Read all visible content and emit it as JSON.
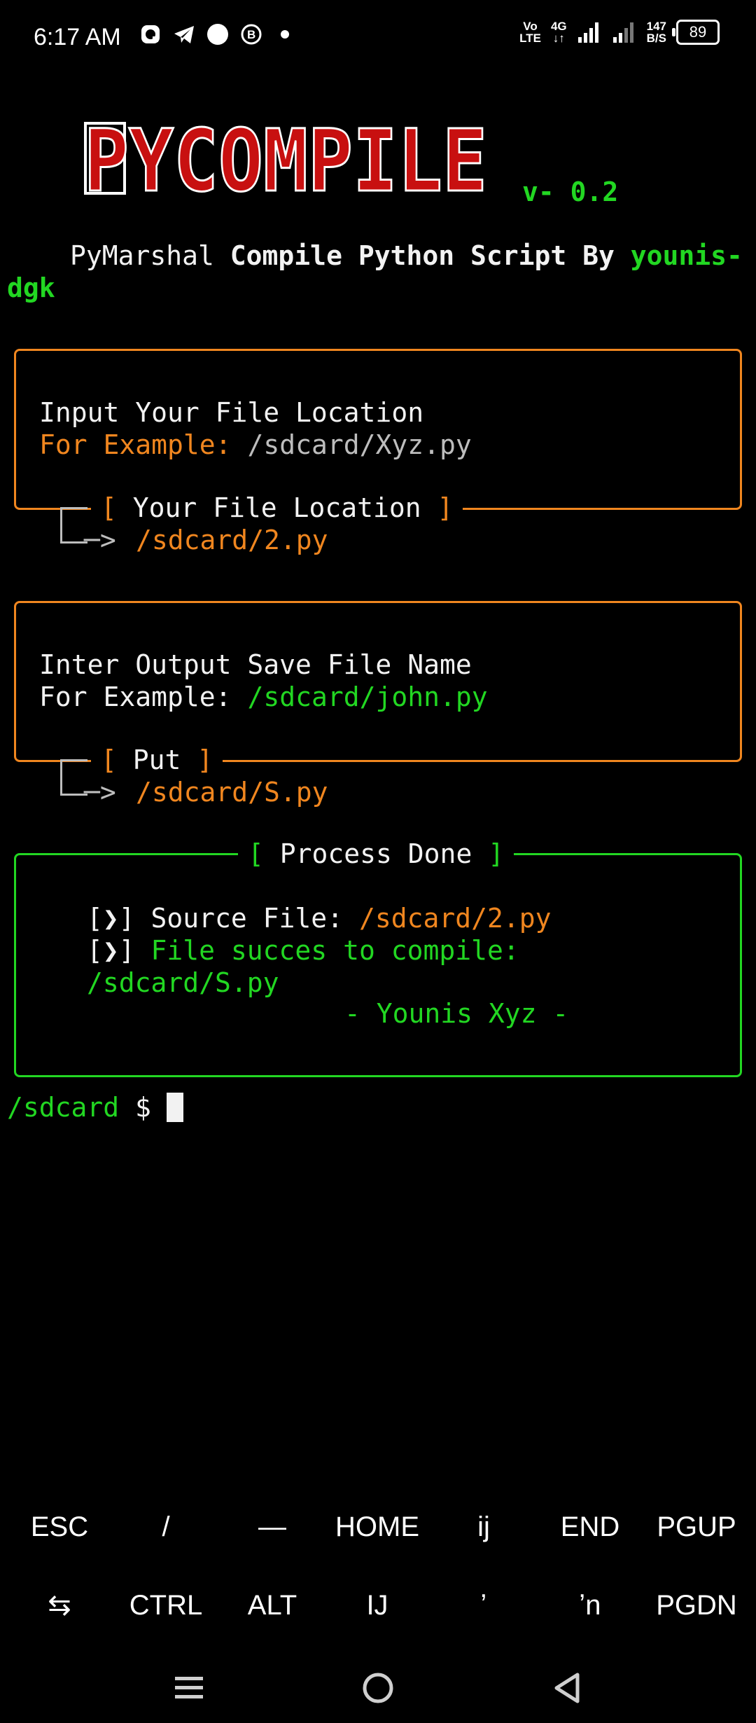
{
  "status_bar": {
    "time": "6:17 AM",
    "volte": "Vo\nLTE",
    "network": "4G",
    "speed": "147\nB/S",
    "battery": "89"
  },
  "header": {
    "logo_text": "PYCOMPILE",
    "version": "v- 0.2",
    "subtitle_prefix": "PyMarshal",
    "subtitle_main": "Compile Python Script By",
    "author": "younis-",
    "author_cont": "dgk"
  },
  "input_box": {
    "line1": "Input Your File Location",
    "example_label": "For Example:",
    "example_value": "/sdcard/Xyz.py",
    "prompt_open": "[",
    "prompt_label": "Your File Location",
    "prompt_close": "]",
    "arrow": "─>",
    "entered": "/sdcard/2.py"
  },
  "output_box": {
    "line1": "Inter Output Save File Name",
    "example_label": "For Example:",
    "example_value": "/sdcard/john.py",
    "prompt_open": "[",
    "prompt_label": "Put",
    "prompt_close": "]",
    "arrow": "─>",
    "entered": "/sdcard/S.py"
  },
  "done_box": {
    "title_open": "[",
    "title": "Process Done",
    "title_close": "]",
    "bullet": "[❯]",
    "source_label": "Source File:",
    "source_value": "/sdcard/2.py",
    "success_text": "File succes to compile:",
    "success_path": "/sdcard/S.py",
    "signature": "- Younis Xyz -"
  },
  "prompt": {
    "cwd": "/sdcard",
    "symbol": "$"
  },
  "extra_keys": {
    "row1": [
      "ESC",
      "/",
      "—",
      "HOME",
      "ij",
      "END",
      "PGUP"
    ],
    "row2": [
      "⇆",
      "CTRL",
      "ALT",
      "IJ",
      "ʼ",
      "ʼn",
      "PGDN"
    ]
  },
  "colors": {
    "orange": "#f0861f",
    "green": "#22d722",
    "logo_red": "#c81010"
  }
}
